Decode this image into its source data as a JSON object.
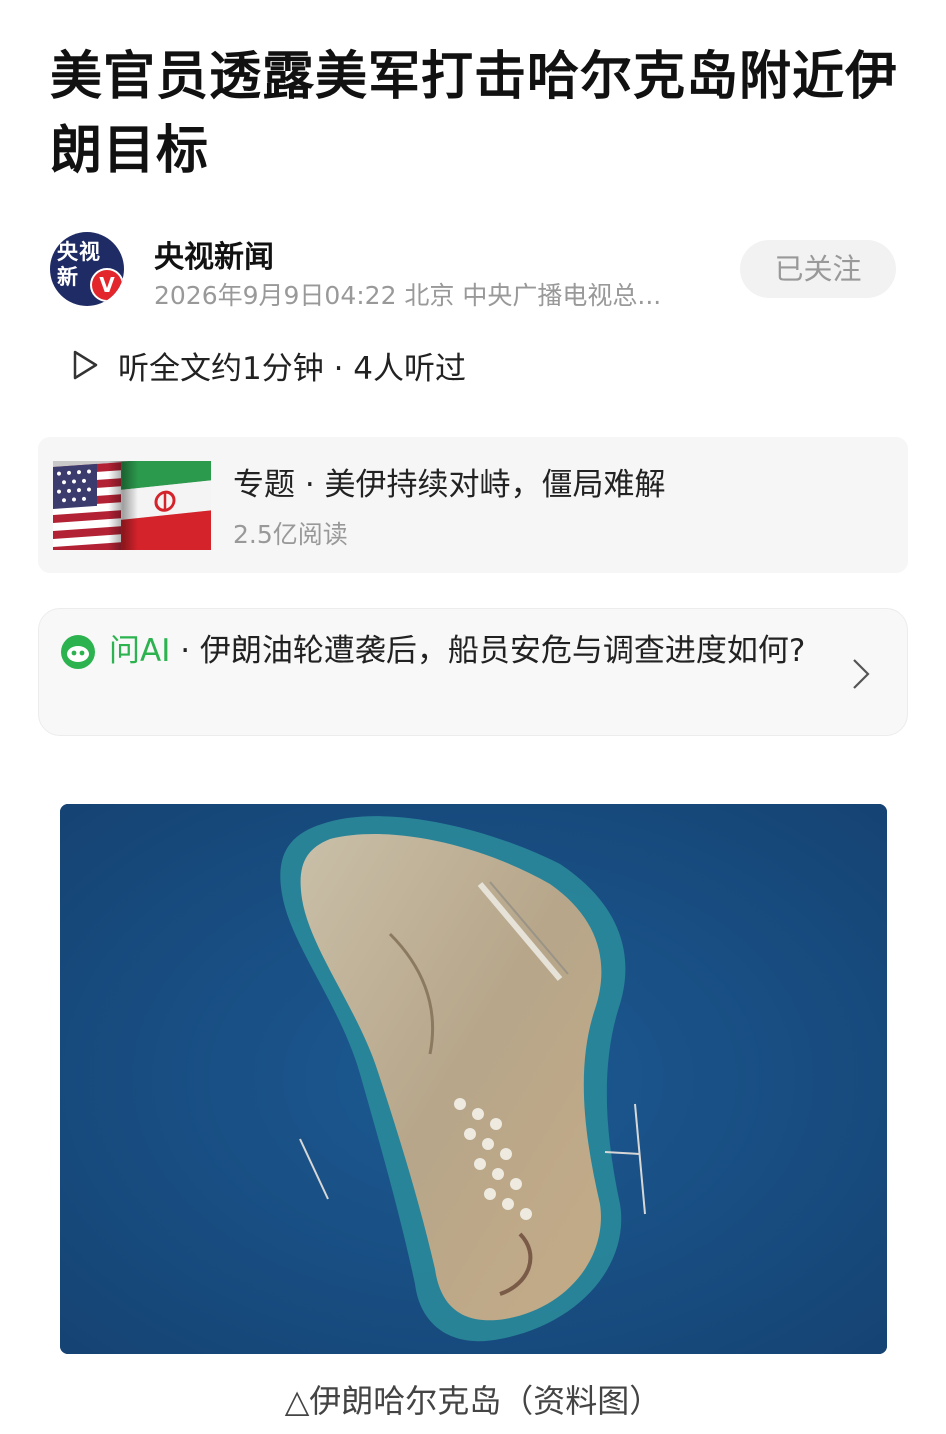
{
  "article": {
    "title": "美官员透露美军打击哈尔克岛附近伊朗目标"
  },
  "author": {
    "avatar_text": "央视新",
    "verified_badge": "V",
    "name": "央视新闻",
    "meta": "2026年9月9日04:22 北京 中央广播电视总...",
    "follow_label": "已关注"
  },
  "listen": {
    "icon": "play-icon",
    "text": "听全文约1分钟 · 4人听过"
  },
  "topic": {
    "title": "专题 · 美伊持续对峙，僵局难解",
    "reads": "2.5亿阅读"
  },
  "ai": {
    "brand": "问AI",
    "question": " · 伊朗油轮遭袭后，船员安危与调查进度如何?",
    "icon": "ai-assistant-icon"
  },
  "photo": {
    "caption": "△伊朗哈尔克岛（资料图）"
  },
  "colors": {
    "accent_green": "#2cb34f",
    "meta_gray": "#999999",
    "card_bg": "#f6f6f6"
  }
}
